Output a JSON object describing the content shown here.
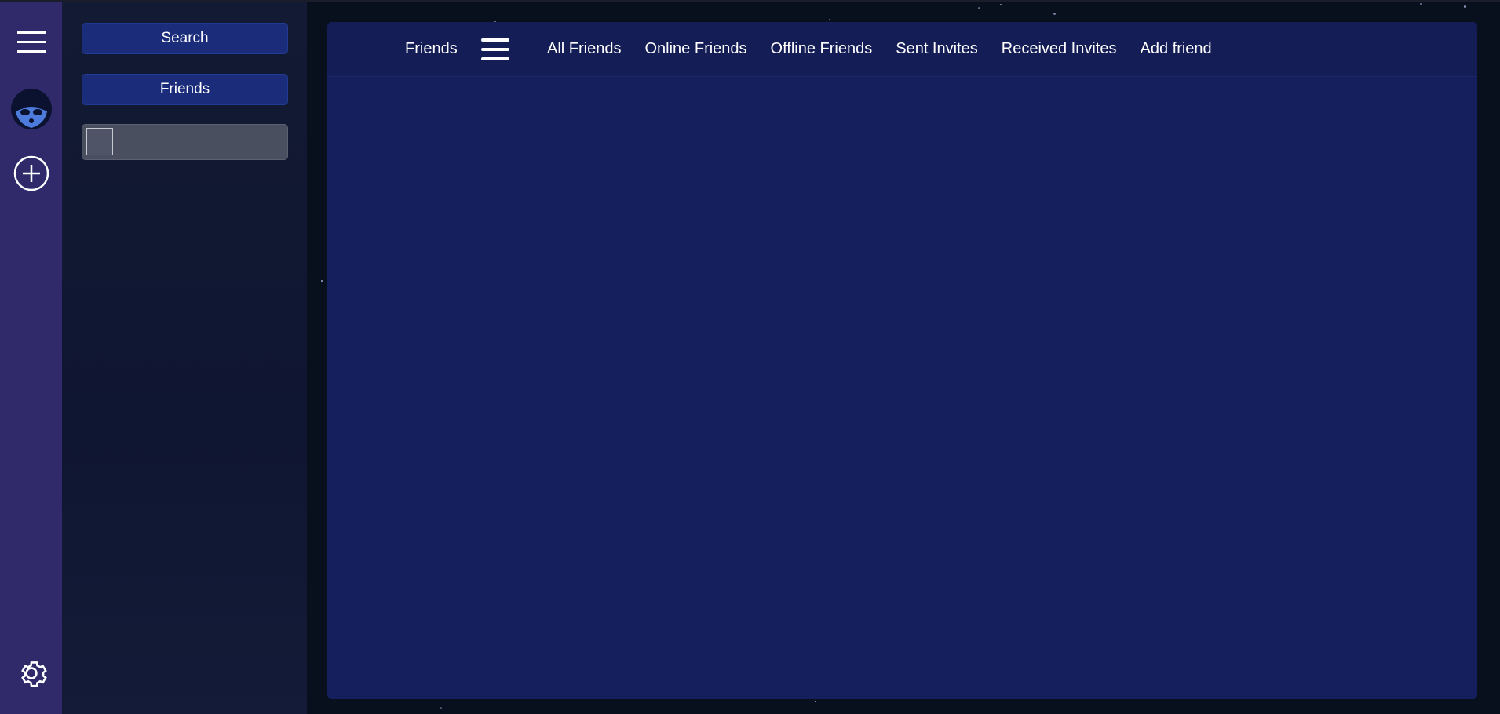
{
  "colors": {
    "rail": "#302a6b",
    "sidebar": "#131a33",
    "button": "#1b2d7a",
    "panel": "#151f5e",
    "search_box": "#4a4f60"
  },
  "rail": {
    "menu_icon": "hamburger-menu-icon",
    "avatar_icon": "raccoon-avatar-icon",
    "add_icon": "plus-circle-icon",
    "settings_icon": "gear-icon"
  },
  "sidebar": {
    "search_label": "Search",
    "friends_label": "Friends",
    "search_value": ""
  },
  "header": {
    "title": "Friends",
    "menu_icon": "hamburger-menu-icon",
    "tabs": [
      {
        "label": "All Friends"
      },
      {
        "label": "Online Friends"
      },
      {
        "label": "Offline Friends"
      },
      {
        "label": "Sent Invites"
      },
      {
        "label": "Received Invites"
      },
      {
        "label": "Add friend"
      }
    ]
  }
}
